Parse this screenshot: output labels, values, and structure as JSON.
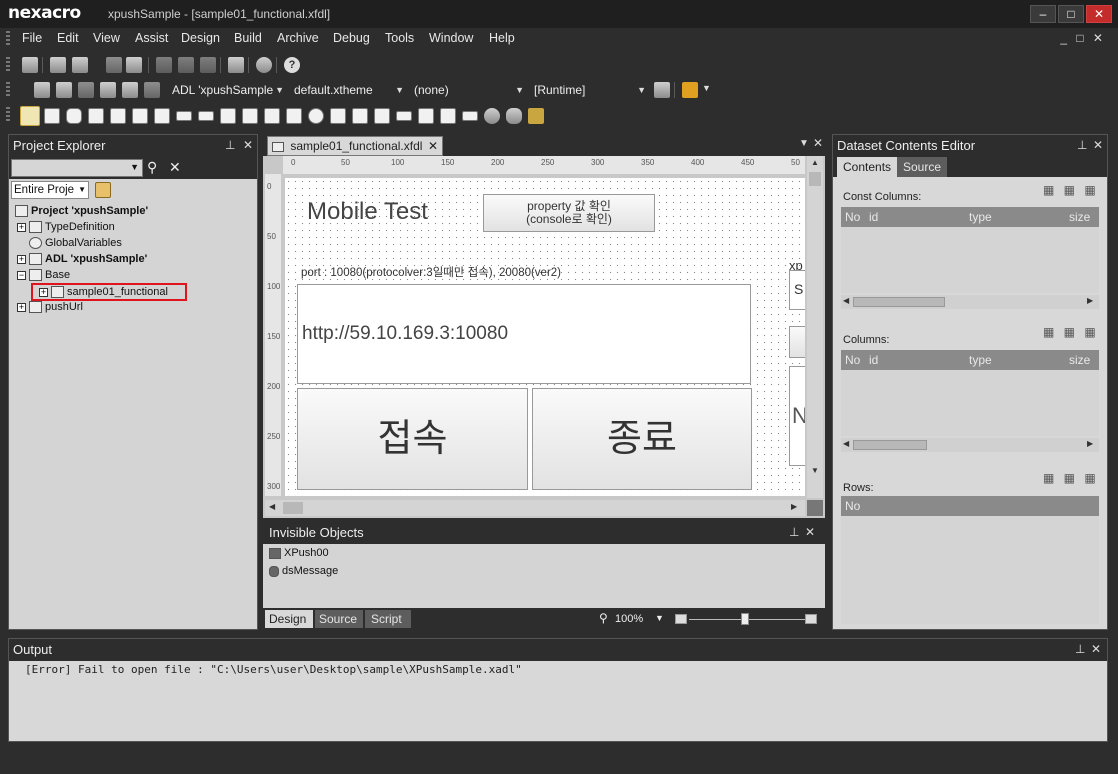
{
  "app": {
    "logo": "nexacro",
    "window_title": "xpushSample - [sample01_functional.xfdl]"
  },
  "menu": [
    "File",
    "Edit",
    "View",
    "Assist",
    "Design",
    "Build",
    "Archive",
    "Debug",
    "Tools",
    "Window",
    "Help"
  ],
  "toolbar": {
    "adl_combo": "ADL 'xpushSample",
    "theme_combo": "default.xtheme",
    "none_combo": "(none)",
    "runtime_combo": "[Runtime]"
  },
  "project_explorer": {
    "title": "Project Explorer",
    "search_value": "",
    "scope_combo": "Entire Proje",
    "tree": [
      {
        "label": "Project 'xpushSample'",
        "bold": true
      },
      {
        "label": "TypeDefinition"
      },
      {
        "label": "GlobalVariables"
      },
      {
        "label": "ADL 'xpushSample'",
        "bold": true
      },
      {
        "label": "Base"
      },
      {
        "label": "sample01_functional",
        "selected": true
      },
      {
        "label": "pushUrl"
      }
    ]
  },
  "editor": {
    "tab_label": "sample01_functional.xfdl",
    "ruler_marks": [
      "0",
      "50",
      "100",
      "150",
      "200",
      "250",
      "300",
      "350",
      "400",
      "450",
      "50"
    ],
    "vruler_marks": [
      "0",
      "50",
      "100",
      "150",
      "200",
      "250",
      "300"
    ],
    "form": {
      "title": "Mobile Test",
      "property_button": "property 값 확인\n(console로 확인)",
      "port_text": "port : 10080(protocolver:3일때만 접속), 20080(ver2)",
      "url_value": "http://59.10.169.3:10080",
      "connect_button": "접속",
      "exit_button": "종료",
      "side_label_xp": "xp",
      "side_label_s": "S",
      "side_label_n": "N"
    },
    "invisible_objects": {
      "title": "Invisible Objects",
      "items": [
        "XPush00",
        "dsMessage"
      ]
    },
    "bottom_tabs": [
      "Design",
      "Source",
      "Script"
    ],
    "zoom": "100%"
  },
  "dataset_editor": {
    "title": "Dataset Contents Editor",
    "tabs": [
      "Contents",
      "Source"
    ],
    "const_columns_label": "Const Columns:",
    "columns_label": "Columns:",
    "rows_label": "Rows:",
    "grid_headers": [
      "No",
      "id",
      "type",
      "size"
    ],
    "rows_header": "No"
  },
  "output": {
    "title": "Output",
    "message": "[Error] Fail to open file : \"C:\\Users\\user\\Desktop\\sample\\XPushSample.xadl\""
  }
}
